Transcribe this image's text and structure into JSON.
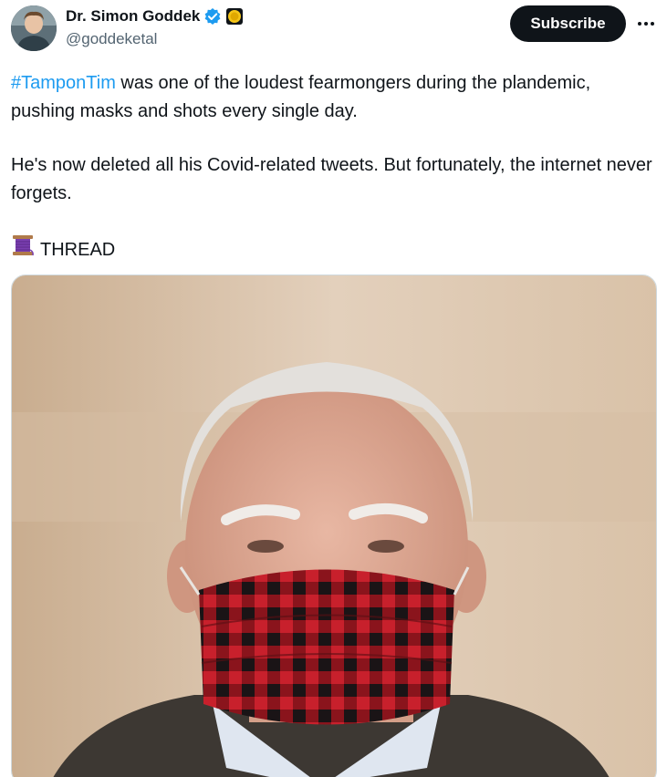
{
  "author": {
    "display_name": "Dr. Simon Goddek",
    "handle": "@goddeketal",
    "verified_badge": "verified-check-icon",
    "affiliate_badge": "gold-circle-badge-icon",
    "verified_color": "#1d9bf0"
  },
  "actions": {
    "subscribe_label": "Subscribe",
    "more_icon": "more-dots-icon"
  },
  "tweet": {
    "hashtag": "#TamponTim",
    "line1_rest": " was one of the loudest fearmongers during the plandemic, pushing masks and shots every single day.",
    "paragraph2": "He's now deleted all his Covid-related tweets. But fortunately, the internet never forgets.",
    "thread_emoji": "spool-of-thread-icon",
    "thread_label": "THREAD"
  },
  "media": {
    "image": "photo-man-in-plaid-face-mask"
  },
  "colors": {
    "text": "#0f1419",
    "secondary": "#536471",
    "link": "#1d9bf0",
    "button_bg": "#0f1419"
  }
}
